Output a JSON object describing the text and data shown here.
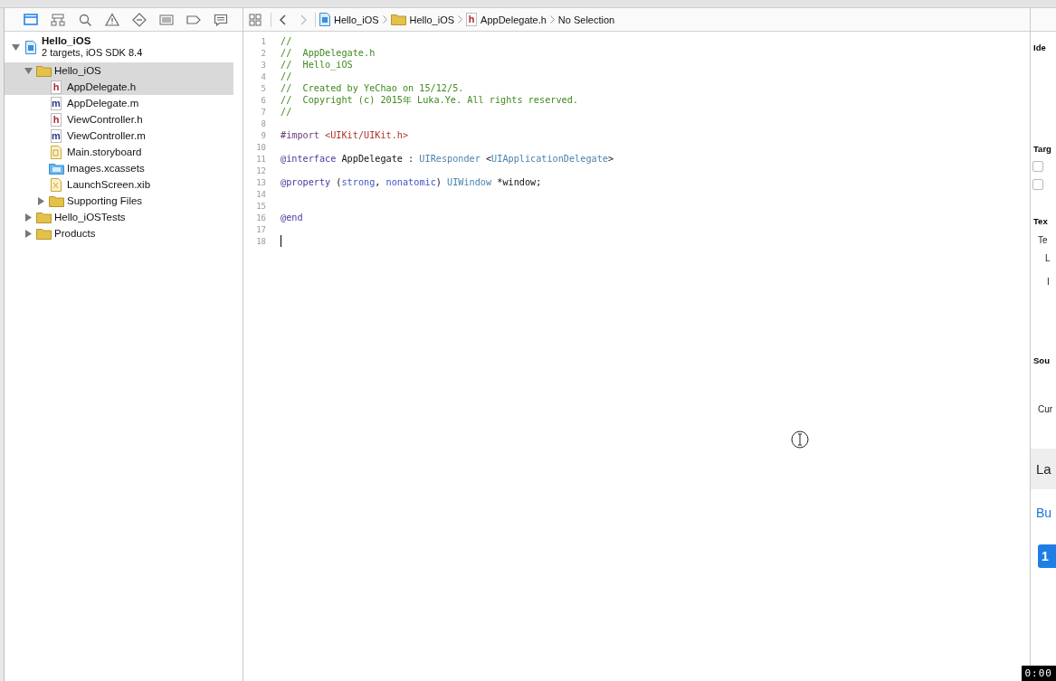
{
  "navigator_tabs": [
    {
      "kind": "folder",
      "selected": true
    },
    {
      "kind": "hierarchy",
      "selected": false
    },
    {
      "kind": "search",
      "selected": false
    },
    {
      "kind": "warning",
      "selected": false
    },
    {
      "kind": "test",
      "selected": false
    },
    {
      "kind": "list",
      "selected": false
    },
    {
      "kind": "tag",
      "selected": false
    },
    {
      "kind": "comment",
      "selected": false
    }
  ],
  "project_tree": [
    {
      "kind": "project",
      "name": "Hello_iOS",
      "subtitle": "2 targets, iOS SDK 8.4",
      "expanded": true,
      "selected": false,
      "children": [
        {
          "kind": "folder",
          "name": "Hello_iOS",
          "expanded": true,
          "selected": true,
          "children": [
            {
              "kind": "header",
              "badge": "h",
              "name": "AppDelegate.h",
              "selected": true
            },
            {
              "kind": "source",
              "badge": "m",
              "name": "AppDelegate.m",
              "selected": false
            },
            {
              "kind": "header",
              "badge": "h",
              "name": "ViewController.h",
              "selected": false
            },
            {
              "kind": "source",
              "badge": "m",
              "name": "ViewController.m",
              "selected": false
            },
            {
              "kind": "storyboard",
              "name": "Main.storyboard",
              "selected": false
            },
            {
              "kind": "assets",
              "name": "Images.xcassets",
              "selected": false
            },
            {
              "kind": "xib",
              "name": "LaunchScreen.xib",
              "selected": false
            },
            {
              "kind": "folder",
              "name": "Supporting Files",
              "expanded": false,
              "selected": false
            }
          ]
        },
        {
          "kind": "folder",
          "name": "Hello_iOSTests",
          "expanded": false,
          "selected": false
        },
        {
          "kind": "folder",
          "name": "Products",
          "expanded": false,
          "selected": false
        }
      ]
    }
  ],
  "editor_toolbar": {
    "back_disabled": false,
    "forward_disabled": true,
    "breadcrumbs": [
      {
        "kind": "project",
        "label": "Hello_iOS"
      },
      {
        "kind": "folder",
        "label": "Hello_iOS"
      },
      {
        "kind": "header",
        "badge": "h",
        "label": "AppDelegate.h"
      },
      {
        "kind": "plain",
        "label": "No Selection"
      }
    ]
  },
  "code_lines": [
    {
      "number": "1",
      "tokens": [
        {
          "kind": "comment",
          "text": "//"
        }
      ]
    },
    {
      "number": "2",
      "tokens": [
        {
          "kind": "comment",
          "text": "//  AppDelegate.h"
        }
      ]
    },
    {
      "number": "3",
      "tokens": [
        {
          "kind": "comment",
          "text": "//  Hello_iOS"
        }
      ]
    },
    {
      "number": "4",
      "tokens": [
        {
          "kind": "comment",
          "text": "//"
        }
      ]
    },
    {
      "number": "5",
      "tokens": [
        {
          "kind": "comment",
          "text": "//  Created by YeChao on 15/12/5."
        }
      ]
    },
    {
      "number": "6",
      "tokens": [
        {
          "kind": "comment",
          "text": "//  Copyright (c) 2015年 Luka.Ye. All rights reserved."
        }
      ]
    },
    {
      "number": "7",
      "tokens": [
        {
          "kind": "comment",
          "text": "//"
        }
      ]
    },
    {
      "number": "8"
    },
    {
      "number": "9",
      "tokens": [
        {
          "kind": "directive",
          "text": "#import "
        },
        {
          "kind": "string",
          "text": "<UIKit/UIKit.h>"
        }
      ]
    },
    {
      "number": "10"
    },
    {
      "number": "11",
      "tokens": [
        {
          "kind": "keyword",
          "text": "@interface"
        },
        {
          "kind": "plain",
          "text": " AppDelegate : "
        },
        {
          "kind": "type",
          "text": "UIResponder"
        },
        {
          "kind": "plain",
          "text": " <"
        },
        {
          "kind": "type",
          "text": "UIApplicationDelegate"
        },
        {
          "kind": "plain",
          "text": ">"
        }
      ]
    },
    {
      "number": "12"
    },
    {
      "number": "13",
      "tokens": [
        {
          "kind": "keyword",
          "text": "@property"
        },
        {
          "kind": "plain",
          "text": " ("
        },
        {
          "kind": "attribute",
          "text": "strong"
        },
        {
          "kind": "plain",
          "text": ", "
        },
        {
          "kind": "attribute",
          "text": "nonatomic"
        },
        {
          "kind": "plain",
          "text": ") "
        },
        {
          "kind": "type",
          "text": "UIWindow"
        },
        {
          "kind": "plain",
          "text": " *window;"
        }
      ]
    },
    {
      "number": "14"
    },
    {
      "number": "15"
    },
    {
      "number": "16",
      "tokens": [
        {
          "kind": "keyword",
          "text": "@end"
        }
      ]
    },
    {
      "number": "17"
    },
    {
      "number": "18",
      "caret": true
    }
  ],
  "inspector": [
    {
      "kind": "heading",
      "text": "Ide"
    },
    {
      "kind": "heading",
      "text": "Targ"
    },
    {
      "kind": "checkbox",
      "checked": false
    },
    {
      "kind": "checkbox",
      "checked": false
    },
    {
      "kind": "heading",
      "text": "Tex"
    },
    {
      "kind": "label",
      "text": "Te"
    },
    {
      "kind": "label",
      "text": "L"
    },
    {
      "kind": "label",
      "text": "I"
    },
    {
      "kind": "heading",
      "text": "Sou"
    },
    {
      "kind": "label",
      "text": "Cur"
    },
    {
      "kind": "large",
      "text": "La"
    },
    {
      "kind": "link",
      "text": "Bu"
    },
    {
      "kind": "blue-button",
      "text": "1"
    }
  ],
  "recording_timer": "0:00"
}
